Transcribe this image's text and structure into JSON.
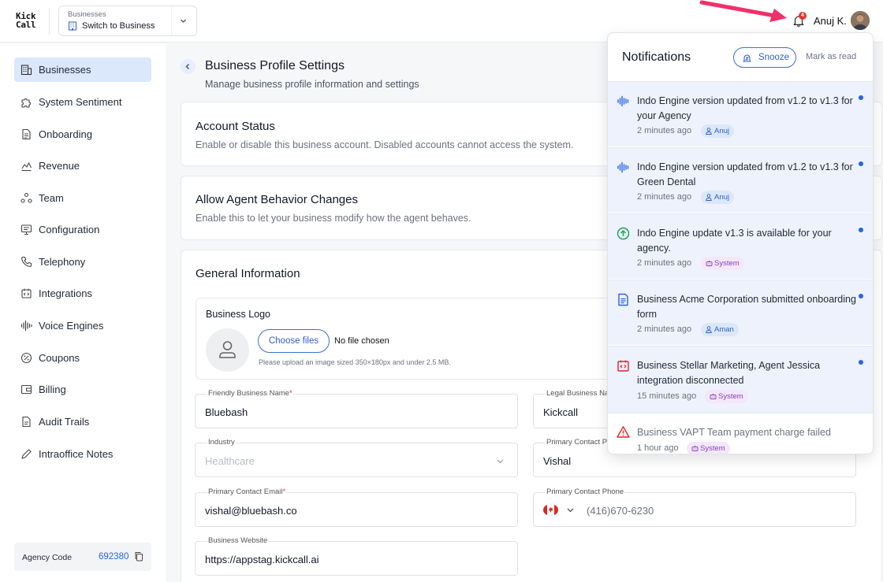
{
  "app": {
    "logo_line1": "Kick",
    "logo_line2": "Call"
  },
  "header": {
    "business_label": "Businesses",
    "business_value": "Switch to Business",
    "notification_count": "4",
    "username": "Anuj K."
  },
  "sidebar": {
    "items": [
      {
        "label": "Businesses",
        "icon": "building-icon",
        "active": true
      },
      {
        "label": "System Sentiment",
        "icon": "puzzle-icon"
      },
      {
        "label": "Onboarding",
        "icon": "document-icon"
      },
      {
        "label": "Revenue",
        "icon": "chart-line-icon"
      },
      {
        "label": "Team",
        "icon": "team-icon"
      },
      {
        "label": "Configuration",
        "icon": "monitor-icon"
      },
      {
        "label": "Telephony",
        "icon": "phone-icon"
      },
      {
        "label": "Integrations",
        "icon": "integration-icon"
      },
      {
        "label": "Voice Engines",
        "icon": "waveform-icon"
      },
      {
        "label": "Coupons",
        "icon": "coupon-icon"
      },
      {
        "label": "Billing",
        "icon": "wallet-icon"
      },
      {
        "label": "Audit Trails",
        "icon": "file-icon"
      },
      {
        "label": "Intraoffice Notes",
        "icon": "pencil-icon"
      }
    ],
    "agency_label": "Agency Code",
    "agency_code": "692380"
  },
  "main": {
    "title": "Business Profile Settings",
    "subtitle": "Manage business profile information and settings",
    "account_status": {
      "title": "Account Status",
      "description": "Enable or disable this business account. Disabled accounts cannot access the system."
    },
    "agent_behavior": {
      "title": "Allow Agent Behavior Changes",
      "description": "Enable this to let your business modify how the agent behaves."
    },
    "general": {
      "title": "General Information",
      "logo_label": "Business Logo",
      "choose_files": "Choose files",
      "no_file": "No file chosen",
      "hint": "Please upload an image sized 350×180px and under 2.5 MB.",
      "fields": {
        "friendly_name": {
          "label": "Friendly Business Name",
          "value": "Bluebash"
        },
        "legal_name": {
          "label": "Legal Business Na",
          "value": "Kickcall"
        },
        "industry": {
          "label": "Industry",
          "value": "Healthcare"
        },
        "primary_contact": {
          "label": "Primary Contact P",
          "value": "Vishal"
        },
        "email": {
          "label": "Primary Contact Email",
          "value": "vishal@bluebash.co"
        },
        "phone": {
          "label": "Primary Contact Phone",
          "value": "(416)670-6230"
        },
        "website": {
          "label": "Business Website",
          "value": "https://appstag.kickcall.ai"
        }
      }
    }
  },
  "notifications": {
    "title": "Notifications",
    "snooze": "Snooze",
    "mark_read": "Mark as read",
    "items": [
      {
        "text": "Indo Engine version updated from v1.2 to v1.3 for your Agency",
        "time": "2 minutes ago",
        "tag": "Anuj",
        "tag_type": "user",
        "icon": "waveform-icon",
        "icon_color": "#2563eb",
        "unread": true
      },
      {
        "text": "Indo Engine version updated from v1.2 to v1.3 for Green Dental",
        "time": "2 minutes ago",
        "tag": "Anuj",
        "tag_type": "user",
        "icon": "waveform-icon",
        "icon_color": "#2563eb",
        "unread": true
      },
      {
        "text": "Indo Engine update v1.3 is available for your agency.",
        "time": "2 minutes ago",
        "tag": "System",
        "tag_type": "system",
        "icon": "arrow-up-circle-icon",
        "icon_color": "#16a34a",
        "unread": true
      },
      {
        "text": "Business Acme Corporation submitted onboarding form",
        "time": "2 minutes ago",
        "tag": "Aman",
        "tag_type": "user",
        "icon": "document-icon",
        "icon_color": "#2563eb",
        "unread": true
      },
      {
        "text": "Business Stellar Marketing, Agent Jessica integration disconnected",
        "time": "15 minutes ago",
        "tag": "System",
        "tag_type": "system",
        "icon": "integration-icon",
        "icon_color": "#dc2626",
        "unread": true
      },
      {
        "text": "Business VAPT Team payment charge failed",
        "time": "1 hour ago",
        "tag": "System",
        "tag_type": "system",
        "icon": "warning-icon",
        "icon_color": "#dc2626",
        "unread": false
      }
    ]
  },
  "colors": {
    "accent": "#2563eb",
    "active_nav": "#dbe7fb",
    "unread_bg": "#eef2fc",
    "error": "#e03a2f"
  }
}
